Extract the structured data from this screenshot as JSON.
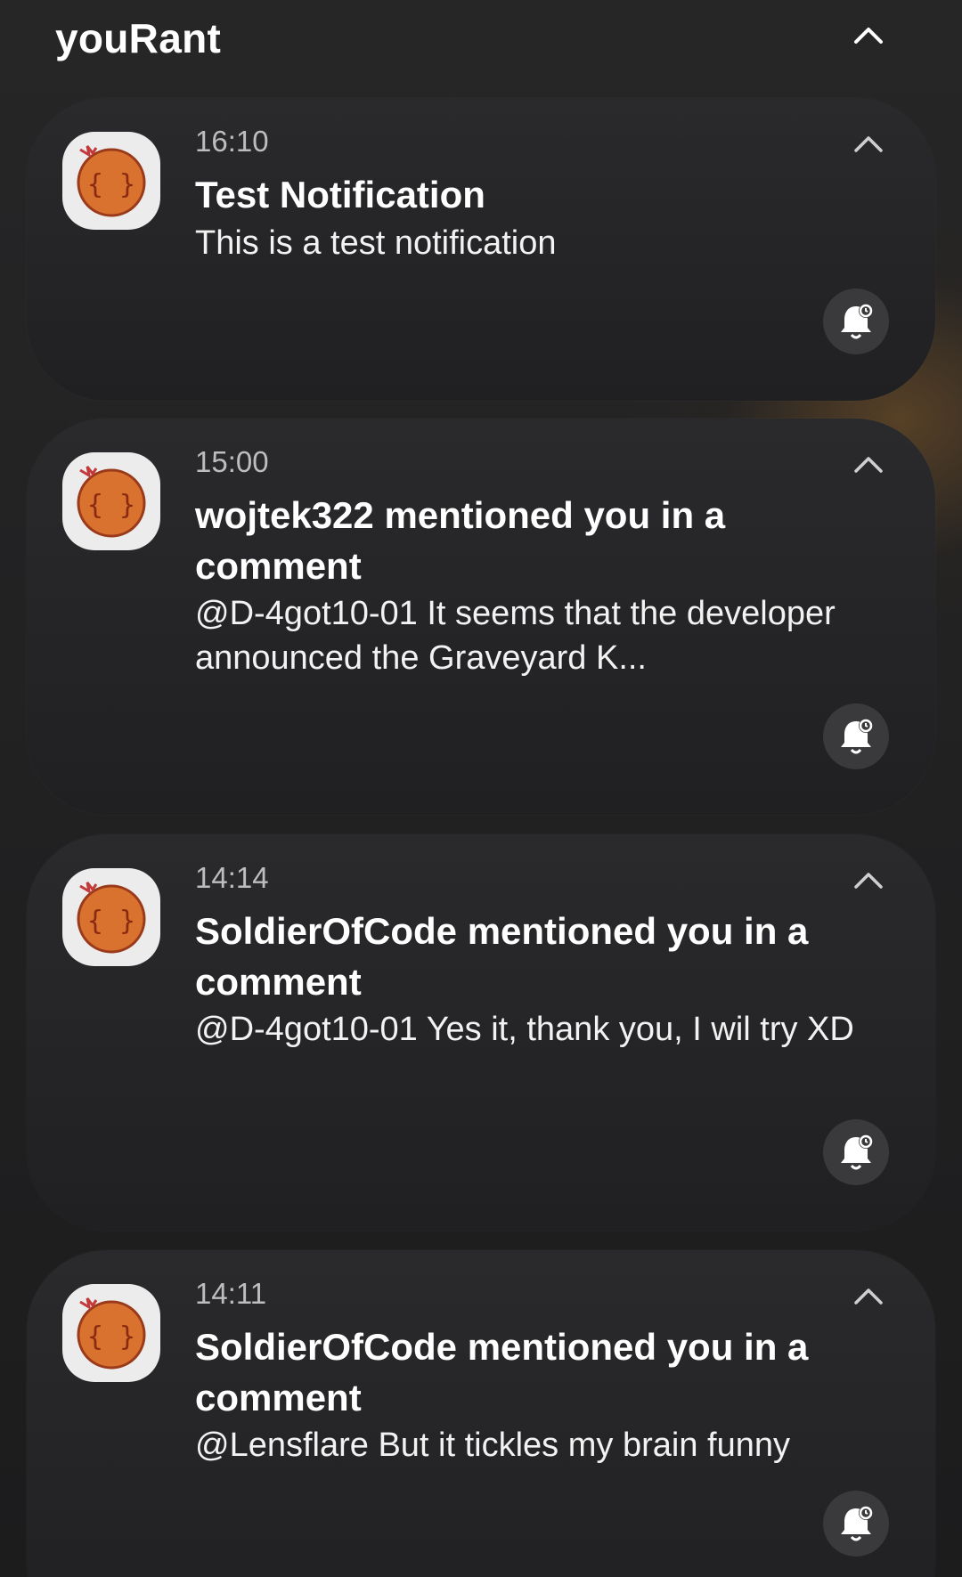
{
  "app": {
    "group_title": "youRant"
  },
  "notifications": [
    {
      "time": "16:10",
      "title": "Test Notification",
      "body": "This is a test notification"
    },
    {
      "time": "15:00",
      "title": "wojtek322 mentioned you in a comment",
      "body": "@D-4got10-01 It seems that the developer announced the Graveyard K..."
    },
    {
      "time": "14:14",
      "title": "SoldierOfCode mentioned you in a comment",
      "body": "@D-4got10-01 Yes it, thank you, I wil try XD"
    },
    {
      "time": "14:11",
      "title": "SoldierOfCode mentioned you in a comment",
      "body": "@Lensflare But it tickles my brain funny"
    }
  ],
  "icons": {
    "collapse": "chevron-up-icon",
    "snooze": "bell-snooze-icon",
    "app": "yourant-app-icon"
  },
  "colors": {
    "background": "#1f1f20",
    "card": "#2a2a2c",
    "app_icon_orange": "#d9722f",
    "app_icon_outline": "#9a3a1a",
    "glow": "#96642a"
  }
}
